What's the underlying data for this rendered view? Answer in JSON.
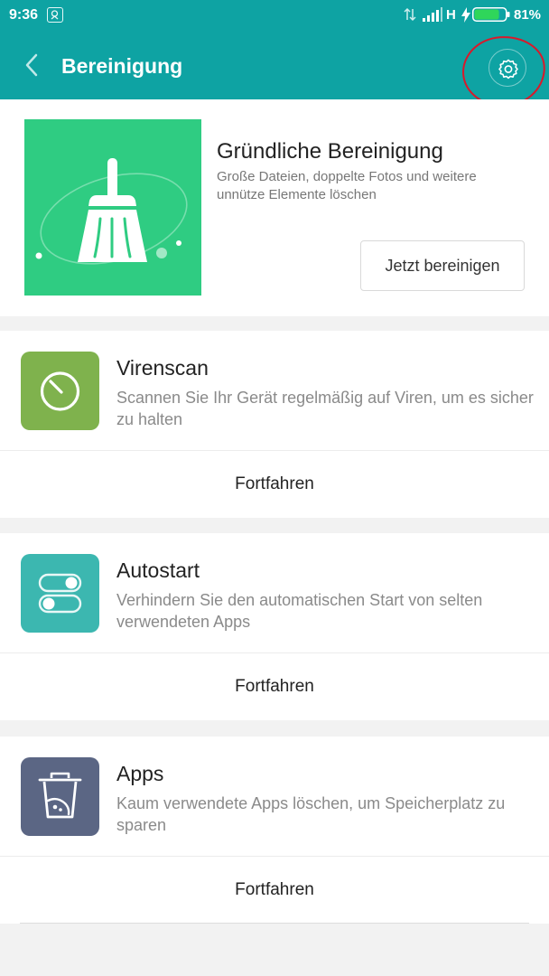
{
  "status_bar": {
    "time": "9:36",
    "network": "H",
    "battery_percent": "81%",
    "battery_level": 0.81,
    "accent_color": "#2fd65a"
  },
  "header": {
    "title": "Bereinigung",
    "background_color": "#0ea3a3",
    "icons": [
      "back-icon",
      "settings-icon"
    ]
  },
  "hero": {
    "title": "Gründliche Bereinigung",
    "description": "Große Dateien, doppelte Fotos und weitere unnütze Elemente löschen",
    "button_label": "Jetzt bereinigen",
    "image_color": "#2fcc82"
  },
  "cards": [
    {
      "title": "Virenscan",
      "description": "Scannen Sie Ihr Gerät regelmäßig auf Viren, um es sicher zu halten",
      "action_label": "Fortfahren",
      "icon": "virus-scan-icon",
      "icon_color": "#7fb24d"
    },
    {
      "title": "Autostart",
      "description": "Verhindern Sie den automatischen Start von selten verwendeten Apps",
      "action_label": "Fortfahren",
      "icon": "toggle-switches-icon",
      "icon_color": "#3cb7b0"
    },
    {
      "title": "Apps",
      "description": "Kaum verwendete Apps löschen, um Speicherplatz zu sparen",
      "action_label": "Fortfahren",
      "icon": "trash-bin-icon",
      "icon_color": "#5b6684"
    }
  ]
}
